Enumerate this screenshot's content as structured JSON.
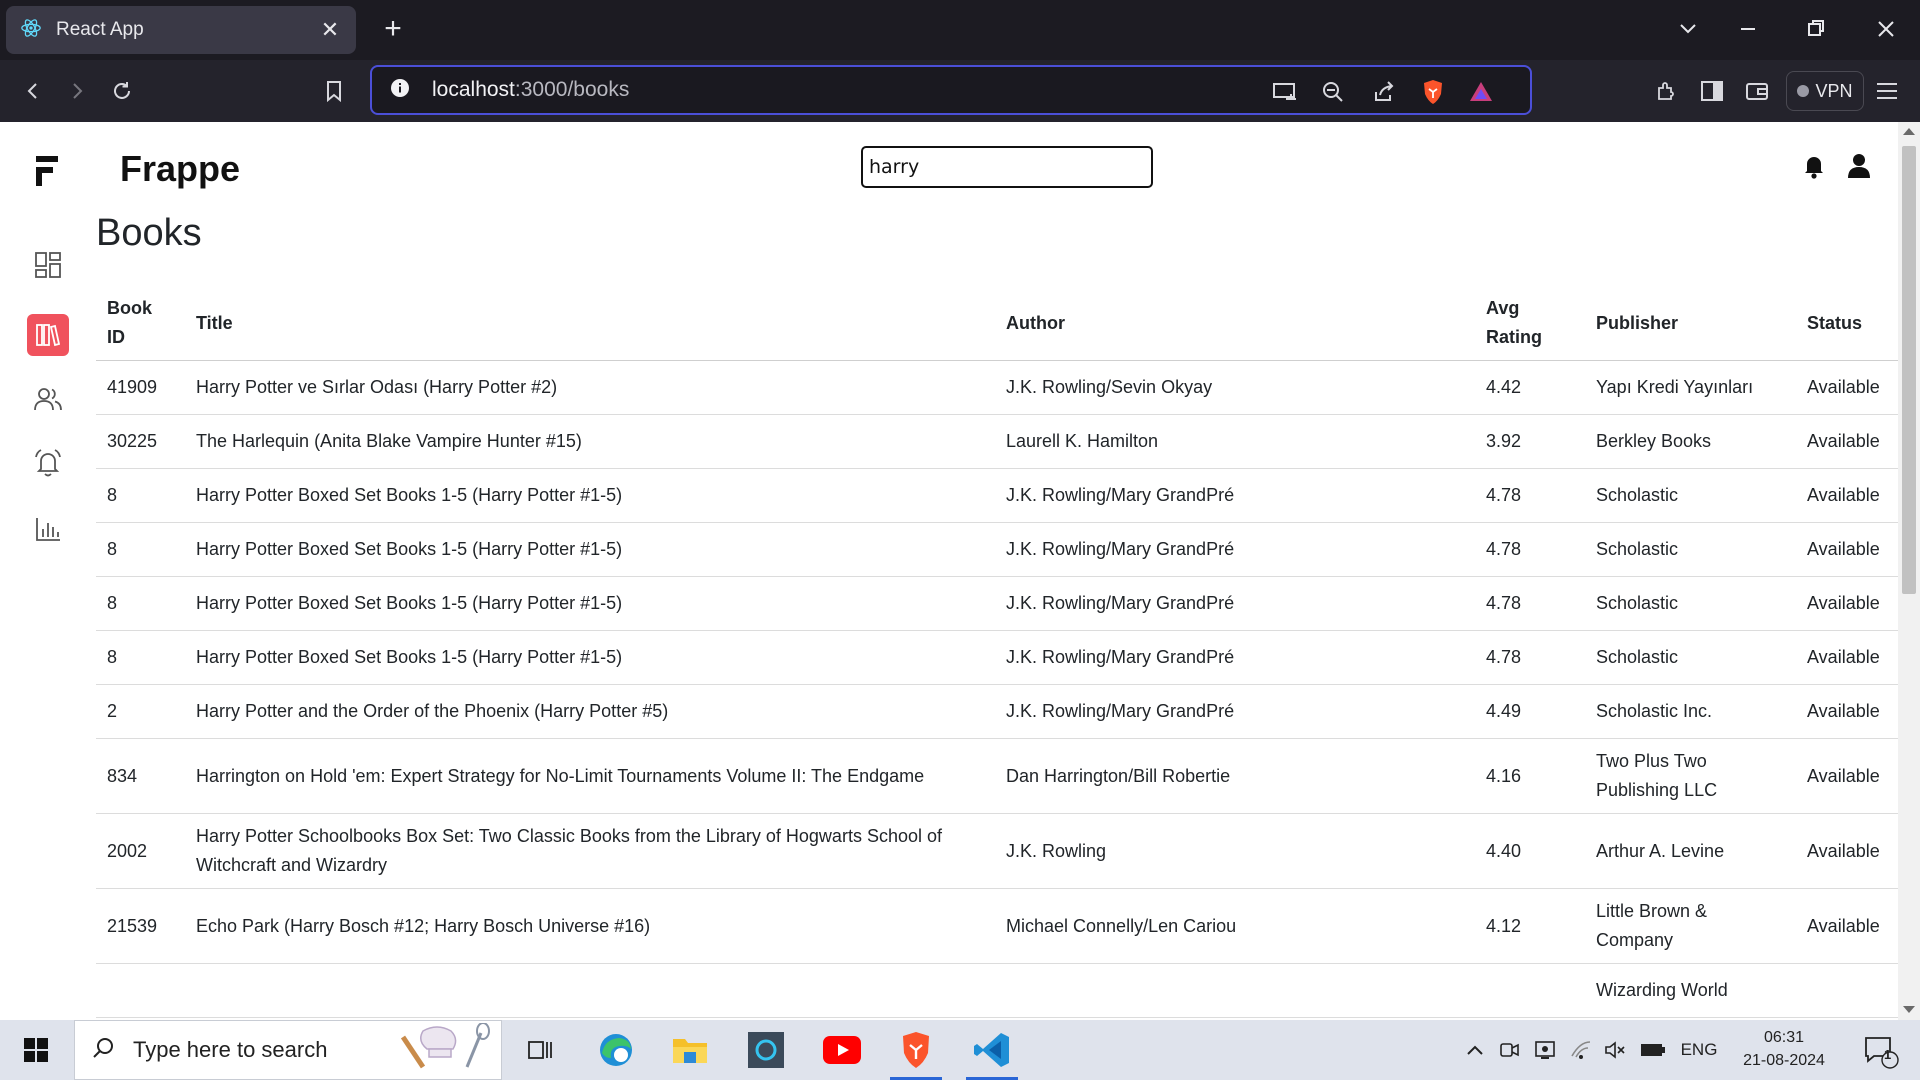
{
  "browser": {
    "tab_title": "React App",
    "url_host": "localhost",
    "url_path": ":3000/books",
    "vpn_label": "VPN"
  },
  "app": {
    "brand": "Frappe",
    "search_value": "harry",
    "page_title": "Books",
    "nav_items": [
      "dashboard-icon",
      "books-icon",
      "users-icon",
      "notifications-icon",
      "reports-icon"
    ],
    "active_nav": "books-icon",
    "accent_color": "#f0525d"
  },
  "table": {
    "columns": {
      "id_line1": "Book",
      "id_line2": "ID",
      "title": "Title",
      "author": "Author",
      "rating_line1": "Avg",
      "rating_line2": "Rating",
      "publisher": "Publisher",
      "status": "Status"
    },
    "rows": [
      {
        "id": "41909",
        "title": "Harry Potter ve Sırlar Odası (Harry Potter #2)",
        "author": "J.K. Rowling/Sevin Okyay",
        "rating": "4.42",
        "publisher": "Yapı Kredi Yayınları",
        "status": "Available"
      },
      {
        "id": "30225",
        "title": "The Harlequin (Anita Blake Vampire Hunter #15)",
        "author": "Laurell K. Hamilton",
        "rating": "3.92",
        "publisher": "Berkley Books",
        "status": "Available"
      },
      {
        "id": "8",
        "title": "Harry Potter Boxed Set Books 1-5 (Harry Potter #1-5)",
        "author": "J.K. Rowling/Mary GrandPré",
        "rating": "4.78",
        "publisher": "Scholastic",
        "status": "Available"
      },
      {
        "id": "8",
        "title": "Harry Potter Boxed Set Books 1-5 (Harry Potter #1-5)",
        "author": "J.K. Rowling/Mary GrandPré",
        "rating": "4.78",
        "publisher": "Scholastic",
        "status": "Available"
      },
      {
        "id": "8",
        "title": "Harry Potter Boxed Set Books 1-5 (Harry Potter #1-5)",
        "author": "J.K. Rowling/Mary GrandPré",
        "rating": "4.78",
        "publisher": "Scholastic",
        "status": "Available"
      },
      {
        "id": "8",
        "title": "Harry Potter Boxed Set Books 1-5 (Harry Potter #1-5)",
        "author": "J.K. Rowling/Mary GrandPré",
        "rating": "4.78",
        "publisher": "Scholastic",
        "status": "Available"
      },
      {
        "id": "2",
        "title": "Harry Potter and the Order of the Phoenix (Harry Potter #5)",
        "author": "J.K. Rowling/Mary GrandPré",
        "rating": "4.49",
        "publisher": "Scholastic Inc.",
        "status": "Available"
      },
      {
        "id": "834",
        "title": "Harrington on Hold 'em: Expert Strategy for No-Limit Tournaments Volume II: The Endgame",
        "author": "Dan Harrington/Bill Robertie",
        "rating": "4.16",
        "publisher": "Two Plus Two Publishing LLC",
        "status": "Available"
      },
      {
        "id": "2002",
        "title": "Harry Potter Schoolbooks Box Set: Two Classic Books from the Library of Hogwarts School of Witchcraft and Wizardry",
        "author": "J.K. Rowling",
        "rating": "4.40",
        "publisher": "Arthur A. Levine",
        "status": "Available"
      },
      {
        "id": "21539",
        "title": "Echo Park (Harry Bosch #12; Harry Bosch Universe #16)",
        "author": "Michael Connelly/Len Cariou",
        "rating": "4.12",
        "publisher": "Little Brown & Company",
        "status": "Available"
      },
      {
        "id": "",
        "title": "",
        "author": "",
        "rating": "",
        "publisher": "Wizarding World",
        "status": ""
      }
    ]
  },
  "taskbar": {
    "search_placeholder": "Type here to search",
    "language": "ENG",
    "time": "06:31",
    "date": "21-08-2024",
    "notification_count": "1"
  }
}
